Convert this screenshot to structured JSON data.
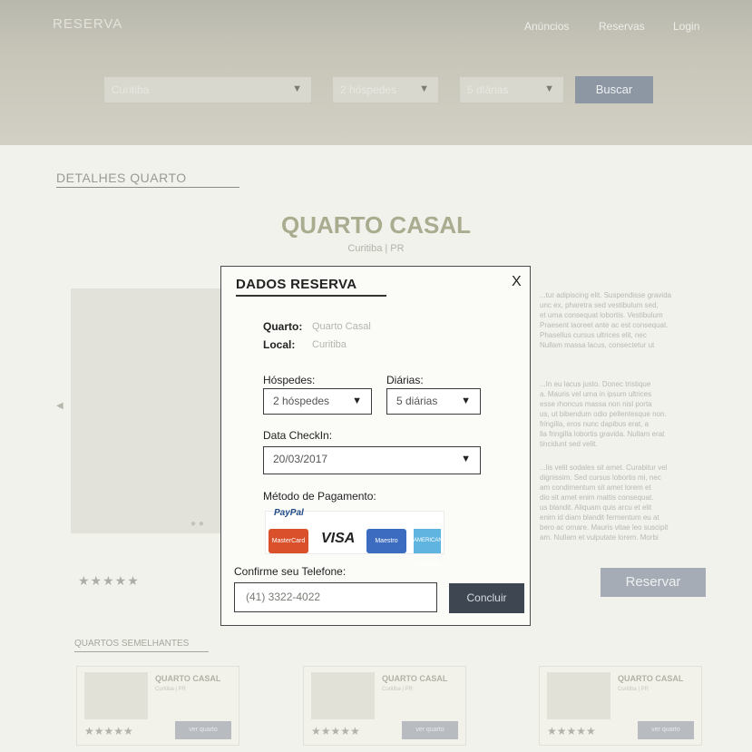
{
  "nav": {
    "logo": "RESERVA",
    "links": [
      "Anúncios",
      "Reservas",
      "Login"
    ]
  },
  "search": {
    "city": "Curitiba",
    "guests": "2 hóspedes",
    "nights": "5 diárias",
    "button": "Buscar"
  },
  "details": {
    "section_title": "DETALHES QUARTO",
    "room_title": "QUARTO CASAL",
    "room_subtitle": "Curitiba | PR"
  },
  "description": [
    "...tur adipiscing elit. Suspendisse gravida\nunc ex, pharetra sed vestibulum sed,\net urna consequat lobortis. Vestibulum\nPraesent laoreet ante ac est consequat.\nPhasellus cursus ultrices elit, nec\nNullam massa lacus, consectetur ut",
    "...In eu lacus justo. Donec tristique\na. Mauris vel urna in ipsum ultrices\nesse rhoncus massa non nisl porta\nus, ut bibendum odio pellentesque non.\nfringilla, eros nunc dapibus erat, a\nlla fringilla lobortis gravida. Nullam erat\ntincidunt sed velit.",
    "...lis velit sodales sit amet. Curabitur vel\ndignissim. Sed cursus lobortis mi, nec\nam condimentum sit amet lorem et\ndio sit amet enim mattis consequat.\nus blandit. Aliquam quis arcu et elit\nenim id diam blandit fermentum eu at\nbero ac ornare. Mauris vitae leo suscipit\nam. Nullam et vulputate lorem. Morbi"
  ],
  "rating": {
    "stars": "★★★★★"
  },
  "reserve_button": "Reservar",
  "similar": {
    "section_title": "QUARTOS SEMELHANTES",
    "cards": [
      {
        "title": "QUARTO CASAL",
        "subtitle": "Curitiba | PR",
        "stars": "★★★★★",
        "button": "ver quarto"
      },
      {
        "title": "QUARTO CASAL",
        "subtitle": "Curitiba | PR",
        "stars": "★★★★★",
        "button": "ver quarto"
      },
      {
        "title": "QUARTO CASAL",
        "subtitle": "Curitiba | PR",
        "stars": "★★★★★",
        "button": "ver quarto"
      }
    ]
  },
  "modal": {
    "title": "DADOS RESERVA",
    "close": "X",
    "room_label": "Quarto:",
    "room_value": "Quarto Casal",
    "location_label": "Local:",
    "location_value": "Curitiba",
    "guests_label": "Hóspedes:",
    "guests_value": "2 hóspedes",
    "nights_label": "Diárias:",
    "nights_value": "5 diárias",
    "checkin_label": "Data CheckIn:",
    "checkin_value": "20/03/2017",
    "payment_label": "Método de Pagamento:",
    "payment": {
      "paypal": "PayPal",
      "mastercard": "MasterCard",
      "visa": "VISA",
      "maestro": "Maestro",
      "amex": "AMERICAN EXPRESS"
    },
    "phone_label": "Confirme seu Telefone:",
    "phone_value": "(41) 3322-4022",
    "submit": "Concluir"
  }
}
